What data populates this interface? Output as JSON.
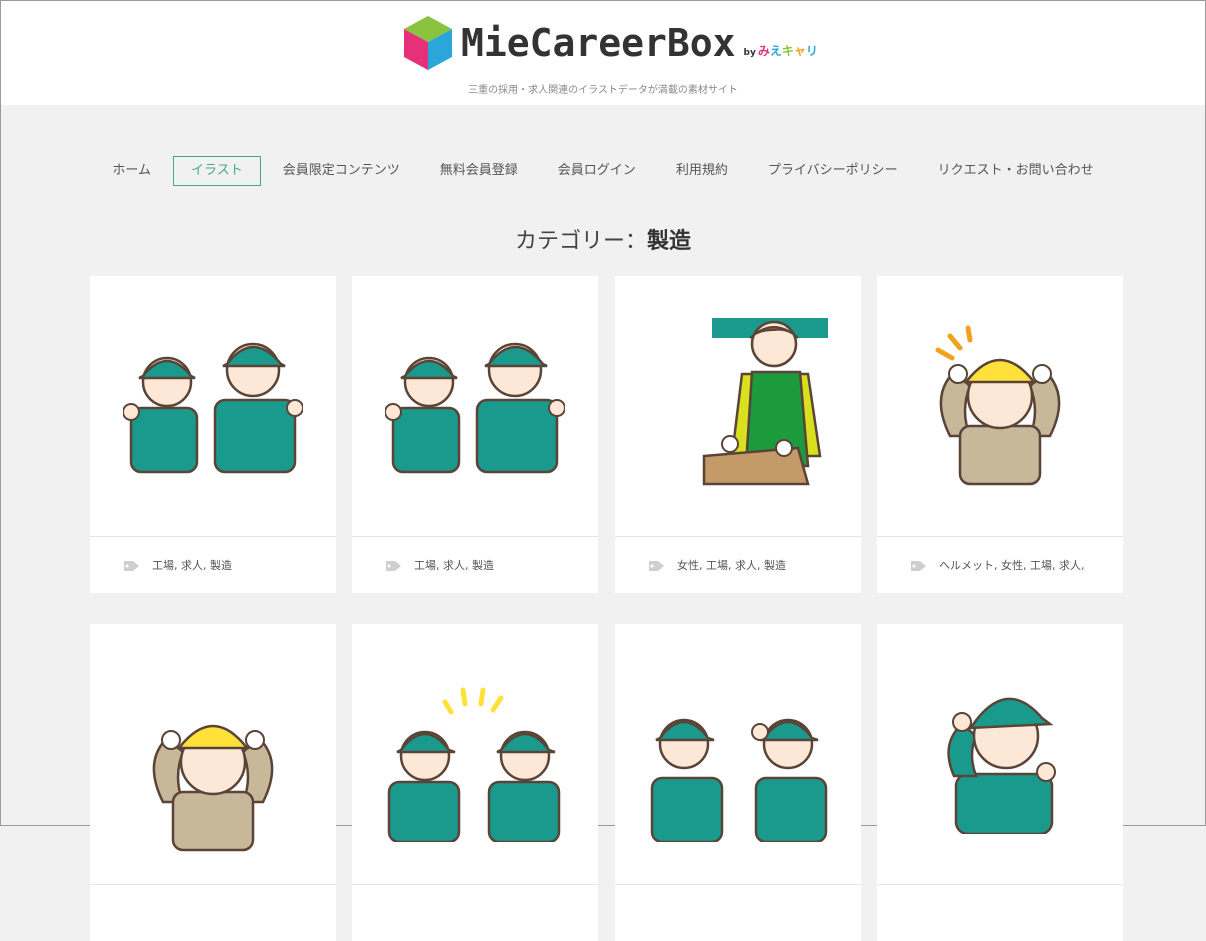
{
  "site": {
    "logo_text": "MieCareerBox",
    "logo_by_prefix": "by",
    "logo_by_chars": [
      "み",
      "え",
      "キ",
      "ャ",
      "リ"
    ],
    "tagline": "三重の採用・求人関連のイラストデータが満載の素材サイト",
    "colors": {
      "accent": "#46a88a",
      "cube_top": "#8ac33f",
      "cube_left": "#e6317a",
      "cube_right": "#2aa7d8",
      "uniform": "#1a9a8c",
      "outline": "#5a4438"
    }
  },
  "nav": {
    "items": [
      {
        "label": "ホーム",
        "active": false
      },
      {
        "label": "イラスト",
        "active": true
      },
      {
        "label": "会員限定コンテンツ",
        "active": false
      },
      {
        "label": "無料会員登録",
        "active": false
      },
      {
        "label": "会員ログイン",
        "active": false
      },
      {
        "label": "利用規約",
        "active": false
      },
      {
        "label": "プライバシーポリシー",
        "active": false
      },
      {
        "label": "リクエスト・お問い合わせ",
        "active": false
      }
    ]
  },
  "page": {
    "title_prefix": "カテゴリー：",
    "title_category": "製造"
  },
  "cards": [
    {
      "tags": "工場, 求人, 製造",
      "illustration": "two-workers-cap-icon"
    },
    {
      "tags": "工場, 求人, 製造",
      "illustration": "two-workers-cap-icon"
    },
    {
      "tags": "女性, 工場, 求人, 製造",
      "illustration": "woman-apron-box-icon"
    },
    {
      "tags": "ヘルメット, 女性, 工場, 求人,",
      "illustration": "woman-helmet-icon"
    },
    {
      "tags": "",
      "illustration": "woman-helmet-icon"
    },
    {
      "tags": "",
      "illustration": "two-workers-cheer-icon"
    },
    {
      "tags": "",
      "illustration": "two-workers-salute-icon"
    },
    {
      "tags": "",
      "illustration": "woman-cap-wink-icon"
    }
  ]
}
